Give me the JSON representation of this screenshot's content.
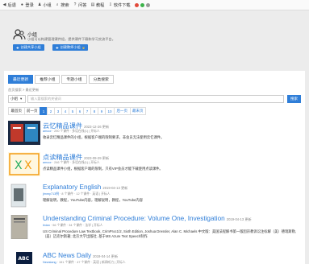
{
  "nav": {
    "items": [
      {
        "label": "后退",
        "icon": "back-icon"
      },
      {
        "label": "登录",
        "icon": "user-icon"
      },
      {
        "label": "小组",
        "icon": "group-icon"
      },
      {
        "label": "搜索",
        "icon": "search-icon"
      },
      {
        "label": "问答",
        "icon": "qa-icon"
      },
      {
        "label": "教程",
        "icon": "book-icon"
      },
      {
        "label": "软件下载",
        "icon": "download-icon"
      }
    ]
  },
  "group": {
    "title": "小组",
    "description": "小组可以构建管理课件组，提供课件下载和学习交流平台。",
    "create_btn": "创建共享小组",
    "create_teacher_btn": "创建教师小组"
  },
  "tabs": [
    "最近更新",
    "推荐小组",
    "专题小组",
    "分类搜索"
  ],
  "breadcrumb": "首页搜索 > 最近更新",
  "search": {
    "select": "小组",
    "placeholder": "输入要搜索的关键词",
    "button": "搜索"
  },
  "pager": [
    "最首页",
    "前一页",
    "1",
    "2",
    "3",
    "4",
    "5",
    "6",
    "7",
    "8",
    "9",
    "10",
    "后一页",
    "最末页"
  ],
  "items": [
    {
      "title": "云忆精品课件",
      "date": "2023-12-26 更新",
      "meta_user": "amoor",
      "meta": " · 290 个课件 · 多话在线(1) | 开标人",
      "desc": "收录云忆精品课件的小组，根据客户端的限制要求，非会员无法使用云忆课件。"
    },
    {
      "title": "点读精品课件",
      "date": "2023-09-29 更新",
      "meta_user": "amoor",
      "meta": " · 246 个课件 · 多话在线(1) | 开标人",
      "desc": "点读精品课件小组，根据客户端的限制，只有VIP会员才能下载使用点读课件。"
    },
    {
      "title": "Explanatory English",
      "date": "2019-04-13 更新",
      "meta_user": "jimmy713例",
      "meta": " · 8 个课件 · 12 个课件 · 英语 | 开标人",
      "desc": "理解说明，教程，YouTube内容，理解说明，教程，YouTube内容"
    },
    {
      "title": "Understanding Criminal Procedure: Volume One, Investigation",
      "date": "2019-04-13 更新",
      "meta_user": "linlan",
      "meta": " · 56 个课件 · 34 个课件 · 法学 | 开标人",
      "desc": "US Criminal Procedure Law Textbook, CrimProc1/2, Sixth Edition, Joshua Dressler, Alan C. Michaels 中文版：美国法程解书第一版因宗教诉讼注标解（美）德瑞斯勒, （美）迈克尔斯著; 北京大学出版社. 基于MS Azure Text Speech制作"
    },
    {
      "title": "ABC News Daily",
      "date": "2019-04-14 更新",
      "meta_user": "Newslang",
      "meta": " · 151 个课件 · 47 个课件 · 英语 | 新闻听力 | 开标人",
      "desc": ""
    }
  ]
}
